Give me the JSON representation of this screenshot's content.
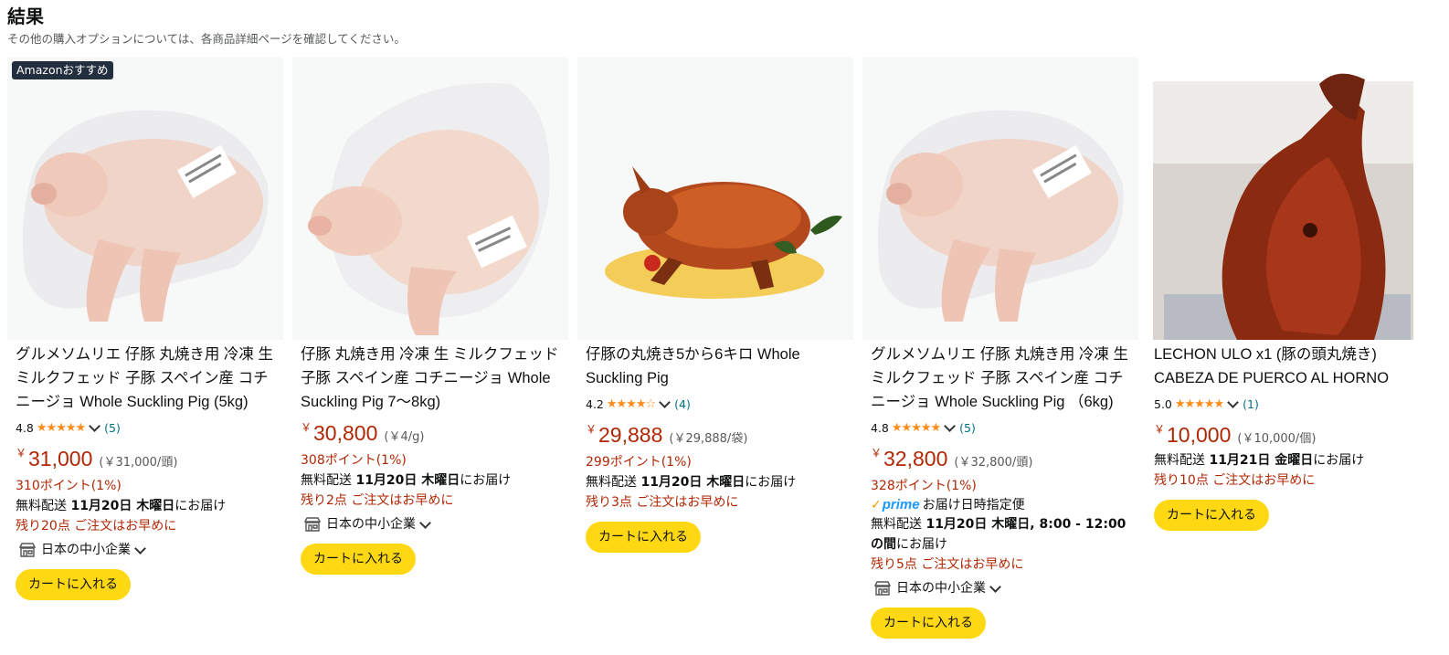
{
  "header": {
    "title": "結果",
    "subtitle": "その他の購入オプションについては、各商品詳細ページを確認してください。"
  },
  "products": [
    {
      "badge": "Amazonおすすめ",
      "title": "グルメソムリエ 仔豚 丸焼き用 冷凍 生 ミルクフェッド 子豚 スペイン産 コチニージョ Whole Suckling Pig (5kg)",
      "rating": "4.8",
      "stars": "★★★★★",
      "reviews": "(5)",
      "currency": "￥",
      "price": "31,000",
      "unit_price": "(￥31,000/頭)",
      "points": "310ポイント(1%)",
      "delivery_prefix": "無料配送 ",
      "delivery_date": "11月20日 木曜日",
      "delivery_suffix": "にお届け",
      "stock": "残り20点 ご注文はお早めに",
      "sme": "日本の中小企業",
      "cart": "カートに入れる"
    },
    {
      "title": "仔豚 丸焼き用 冷凍 生 ミルクフェッド 子豚 スペイン産 コチニージョ Whole Suckling Pig 7～8kg)",
      "currency": "￥",
      "price": "30,800",
      "unit_price": "(￥4/g)",
      "points": "308ポイント(1%)",
      "delivery_prefix": "無料配送 ",
      "delivery_date": "11月20日 木曜日",
      "delivery_suffix": "にお届け",
      "stock": "残り2点 ご注文はお早めに",
      "sme": "日本の中小企業",
      "cart": "カートに入れる"
    },
    {
      "title": "仔豚の丸焼き5から6キロ Whole Suckling Pig",
      "rating": "4.2",
      "stars": "★★★★☆",
      "reviews": "(4)",
      "currency": "￥",
      "price": "29,888",
      "unit_price": "(￥29,888/袋)",
      "points": "299ポイント(1%)",
      "delivery_prefix": "無料配送 ",
      "delivery_date": "11月20日 木曜日",
      "delivery_suffix": "にお届け",
      "stock": "残り3点 ご注文はお早めに",
      "cart": "カートに入れる"
    },
    {
      "title": "グルメソムリエ 仔豚 丸焼き用 冷凍 生 ミルクフェッド 子豚 スペイン産 コチニージョ Whole Suckling Pig （6kg)",
      "rating": "4.8",
      "stars": "★★★★★",
      "reviews": "(5)",
      "currency": "￥",
      "price": "32,800",
      "unit_price": "(￥32,800/頭)",
      "points": "328ポイント(1%)",
      "prime_logo": "prime",
      "prime_text": "お届け日時指定便",
      "delivery_prefix": "無料配送 ",
      "delivery_date": "11月20日 木曜日, 8:00 - 12:00の間",
      "delivery_suffix": "にお届け",
      "stock": "残り5点 ご注文はお早めに",
      "sme": "日本の中小企業",
      "cart": "カートに入れる"
    },
    {
      "title": "LECHON ULO x1 (豚の頭丸焼き) CABEZA DE PUERCO AL HORNO",
      "rating": "5.0",
      "stars": "★★★★★",
      "reviews": "(1)",
      "currency": "￥",
      "price": "10,000",
      "unit_price": "(￥10,000/個)",
      "delivery_prefix": "無料配送 ",
      "delivery_date": "11月21日 金曜日",
      "delivery_suffix": "にお届け",
      "stock": "残り10点 ご注文はお早めに",
      "cart": "カートに入れる"
    }
  ],
  "colors": {
    "price": "#b12704",
    "cart_button": "#ffd814",
    "stars": "#ff8c1a",
    "link": "#007185",
    "prime": "#1a98ff"
  }
}
